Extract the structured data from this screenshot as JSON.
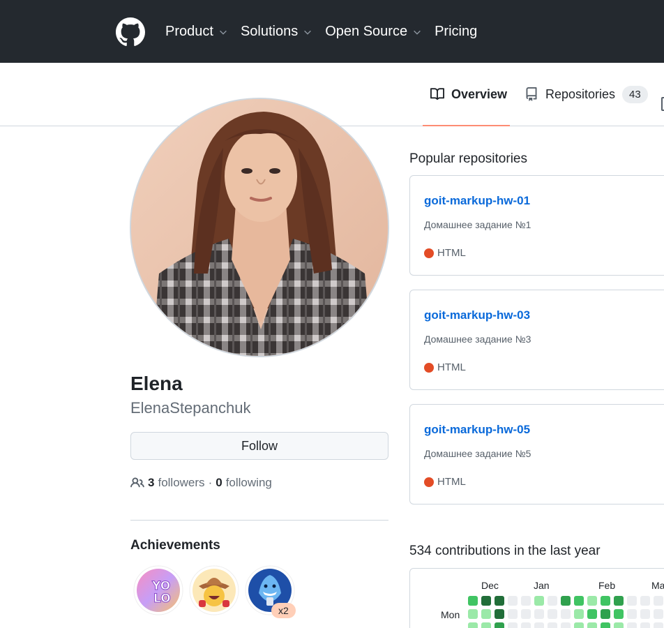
{
  "header": {
    "nav": [
      {
        "label": "Product",
        "has_dropdown": true
      },
      {
        "label": "Solutions",
        "has_dropdown": true
      },
      {
        "label": "Open Source",
        "has_dropdown": true
      },
      {
        "label": "Pricing",
        "has_dropdown": false
      }
    ]
  },
  "tabs": {
    "overview": "Overview",
    "repositories": "Repositories",
    "repositories_count": "43"
  },
  "profile": {
    "name": "Elena",
    "login": "ElenaStepanchuk",
    "follow_label": "Follow",
    "followers_count": "3",
    "followers_label": "followers",
    "separator": "·",
    "following_count": "0",
    "following_label": "following"
  },
  "achievements": {
    "title": "Achievements",
    "badges": [
      {
        "icon": "yolo-badge-icon"
      },
      {
        "icon": "quickdraw-badge-icon"
      },
      {
        "icon": "pull-shark-badge-icon",
        "count": "x2"
      }
    ]
  },
  "popular": {
    "title": "Popular repositories",
    "repos": [
      {
        "name": "goit-markup-hw-01",
        "description": "Домашнее задание №1",
        "language": "HTML"
      },
      {
        "name": "goit-markup-hw-03",
        "description": "Домашнее задание №3",
        "language": "HTML"
      },
      {
        "name": "goit-markup-hw-05",
        "description": "Домашнее задание №5",
        "language": "HTML"
      }
    ],
    "language_color": "#e34c26"
  },
  "contributions": {
    "title": "534 contributions in the last year",
    "months": [
      "Dec",
      "Jan",
      "Feb",
      "Ma"
    ],
    "day_label": "Mon",
    "levels": {
      "0": "#ebedf0",
      "1": "#9be9a8",
      "2": "#40c463",
      "3": "#30a14e",
      "4": "#216e39"
    },
    "rows": [
      [
        2,
        4,
        4,
        0,
        0,
        1,
        0,
        3,
        2,
        1,
        2,
        3,
        0,
        0,
        0,
        0
      ],
      [
        1,
        1,
        4,
        0,
        0,
        0,
        0,
        0,
        1,
        2,
        3,
        2,
        0,
        0,
        0,
        0
      ],
      [
        1,
        1,
        3,
        0,
        0,
        0,
        0,
        0,
        1,
        1,
        2,
        1,
        0,
        0,
        0,
        0
      ]
    ]
  }
}
